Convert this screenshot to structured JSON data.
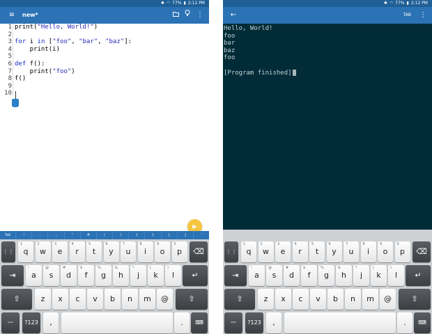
{
  "status": {
    "battery": "77%",
    "time": "2:12 PM"
  },
  "left": {
    "title": "new*",
    "code_lines": [
      {
        "n": "1",
        "segments": [
          {
            "t": "print(",
            "c": ""
          },
          {
            "t": "\"Hello, World!\"",
            "c": "str"
          },
          {
            "t": ")",
            "c": ""
          }
        ]
      },
      {
        "n": "2",
        "segments": []
      },
      {
        "n": "3",
        "segments": [
          {
            "t": "for",
            "c": "kw"
          },
          {
            "t": " i ",
            "c": ""
          },
          {
            "t": "in",
            "c": "kw"
          },
          {
            "t": " [",
            "c": ""
          },
          {
            "t": "\"foo\"",
            "c": "str"
          },
          {
            "t": ", ",
            "c": ""
          },
          {
            "t": "\"bar\"",
            "c": "str"
          },
          {
            "t": ", ",
            "c": ""
          },
          {
            "t": "\"baz\"",
            "c": "str"
          },
          {
            "t": "]:",
            "c": ""
          }
        ]
      },
      {
        "n": "4",
        "segments": [
          {
            "t": "    print(i)",
            "c": ""
          }
        ]
      },
      {
        "n": "5",
        "segments": []
      },
      {
        "n": "6",
        "segments": [
          {
            "t": "def",
            "c": "kw"
          },
          {
            "t": " f():",
            "c": ""
          }
        ]
      },
      {
        "n": "7",
        "segments": [
          {
            "t": "    print(",
            "c": ""
          },
          {
            "t": "\"foo\"",
            "c": "str"
          },
          {
            "t": ")",
            "c": ""
          }
        ]
      },
      {
        "n": "8",
        "segments": [
          {
            "t": "f()",
            "c": ""
          }
        ]
      },
      {
        "n": "9",
        "segments": []
      },
      {
        "n": "10",
        "segments": []
      }
    ],
    "extra_keys": [
      "Tab",
      "!",
      ":",
      ";",
      "\"",
      "#",
      "(",
      ")",
      "{",
      "}",
      "[",
      "]",
      "'"
    ]
  },
  "right": {
    "tab_label": "TAB",
    "output_lines": [
      "Hello, World!",
      "foo",
      "bar",
      "baz",
      "foo",
      "",
      "[Program finished]"
    ]
  },
  "keyboard": {
    "row1": [
      {
        "k": "q",
        "h": "1"
      },
      {
        "k": "w",
        "h": "2"
      },
      {
        "k": "e",
        "h": "3"
      },
      {
        "k": "r",
        "h": "4"
      },
      {
        "k": "t",
        "h": "5"
      },
      {
        "k": "y",
        "h": "6"
      },
      {
        "k": "u",
        "h": "7"
      },
      {
        "k": "i",
        "h": "8"
      },
      {
        "k": "o",
        "h": "9"
      },
      {
        "k": "p",
        "h": "0"
      }
    ],
    "row2": [
      {
        "k": "a",
        "h": "!"
      },
      {
        "k": "s",
        "h": "@"
      },
      {
        "k": "d",
        "h": "#"
      },
      {
        "k": "f",
        "h": "$"
      },
      {
        "k": "g",
        "h": "%"
      },
      {
        "k": "h",
        "h": "&"
      },
      {
        "k": "j",
        "h": "*"
      },
      {
        "k": "k",
        "h": "("
      },
      {
        "k": "l",
        "h": ")"
      }
    ],
    "row3": [
      {
        "k": "z",
        "h": ""
      },
      {
        "k": "x",
        "h": ""
      },
      {
        "k": "c",
        "h": ""
      },
      {
        "k": "v",
        "h": ""
      },
      {
        "k": "b",
        "h": ""
      },
      {
        "k": "n",
        "h": ""
      },
      {
        "k": "m",
        "h": ""
      },
      {
        "k": "@",
        "h": ""
      }
    ],
    "sym_label": "?123",
    "comma": ",",
    "period": "."
  }
}
